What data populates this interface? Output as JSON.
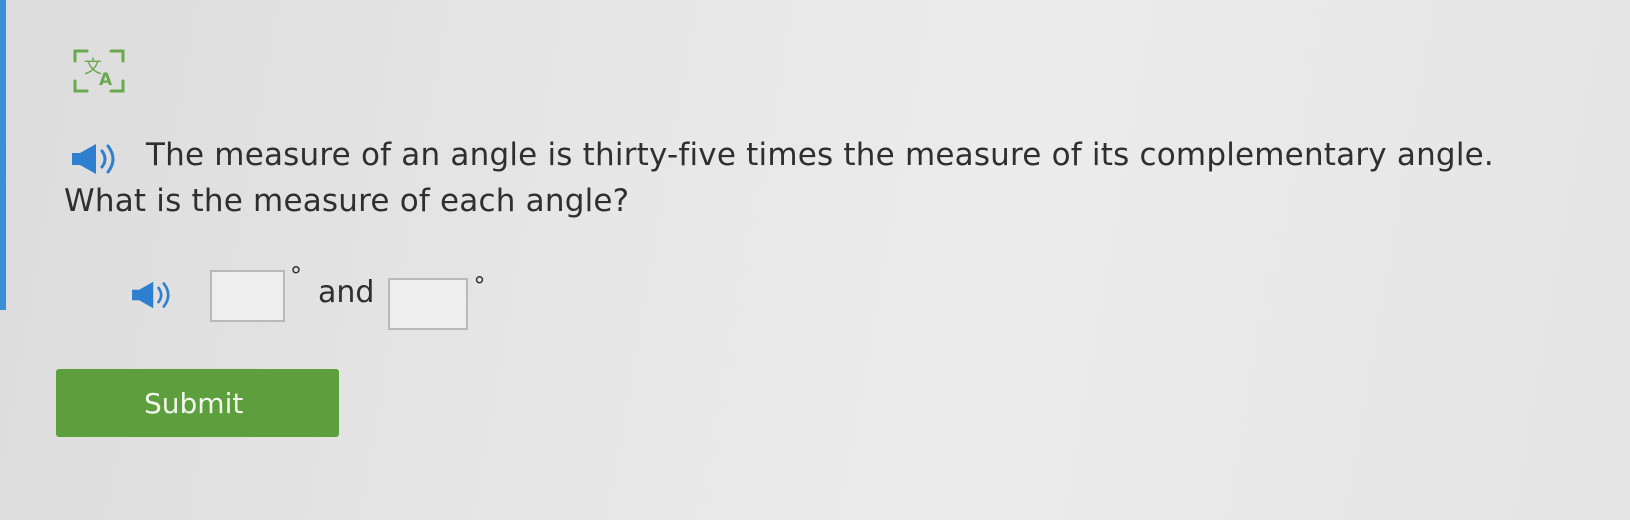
{
  "toolbar": {
    "translate_icon": "translate-icon"
  },
  "question": {
    "audio_icon": "speaker-icon",
    "line1": "The measure of an angle is thirty-five times the measure of its complementary angle.",
    "line2": "What is the measure of each angle?"
  },
  "answer": {
    "audio_icon": "speaker-icon",
    "first_value": "",
    "second_value": "",
    "degree_symbol": "°",
    "connector": "and"
  },
  "submit": {
    "label": "Submit"
  },
  "colors": {
    "accent_green": "#5c9f3c",
    "speaker_blue": "#2e7fd0",
    "translate_green": "#6aa84f"
  }
}
